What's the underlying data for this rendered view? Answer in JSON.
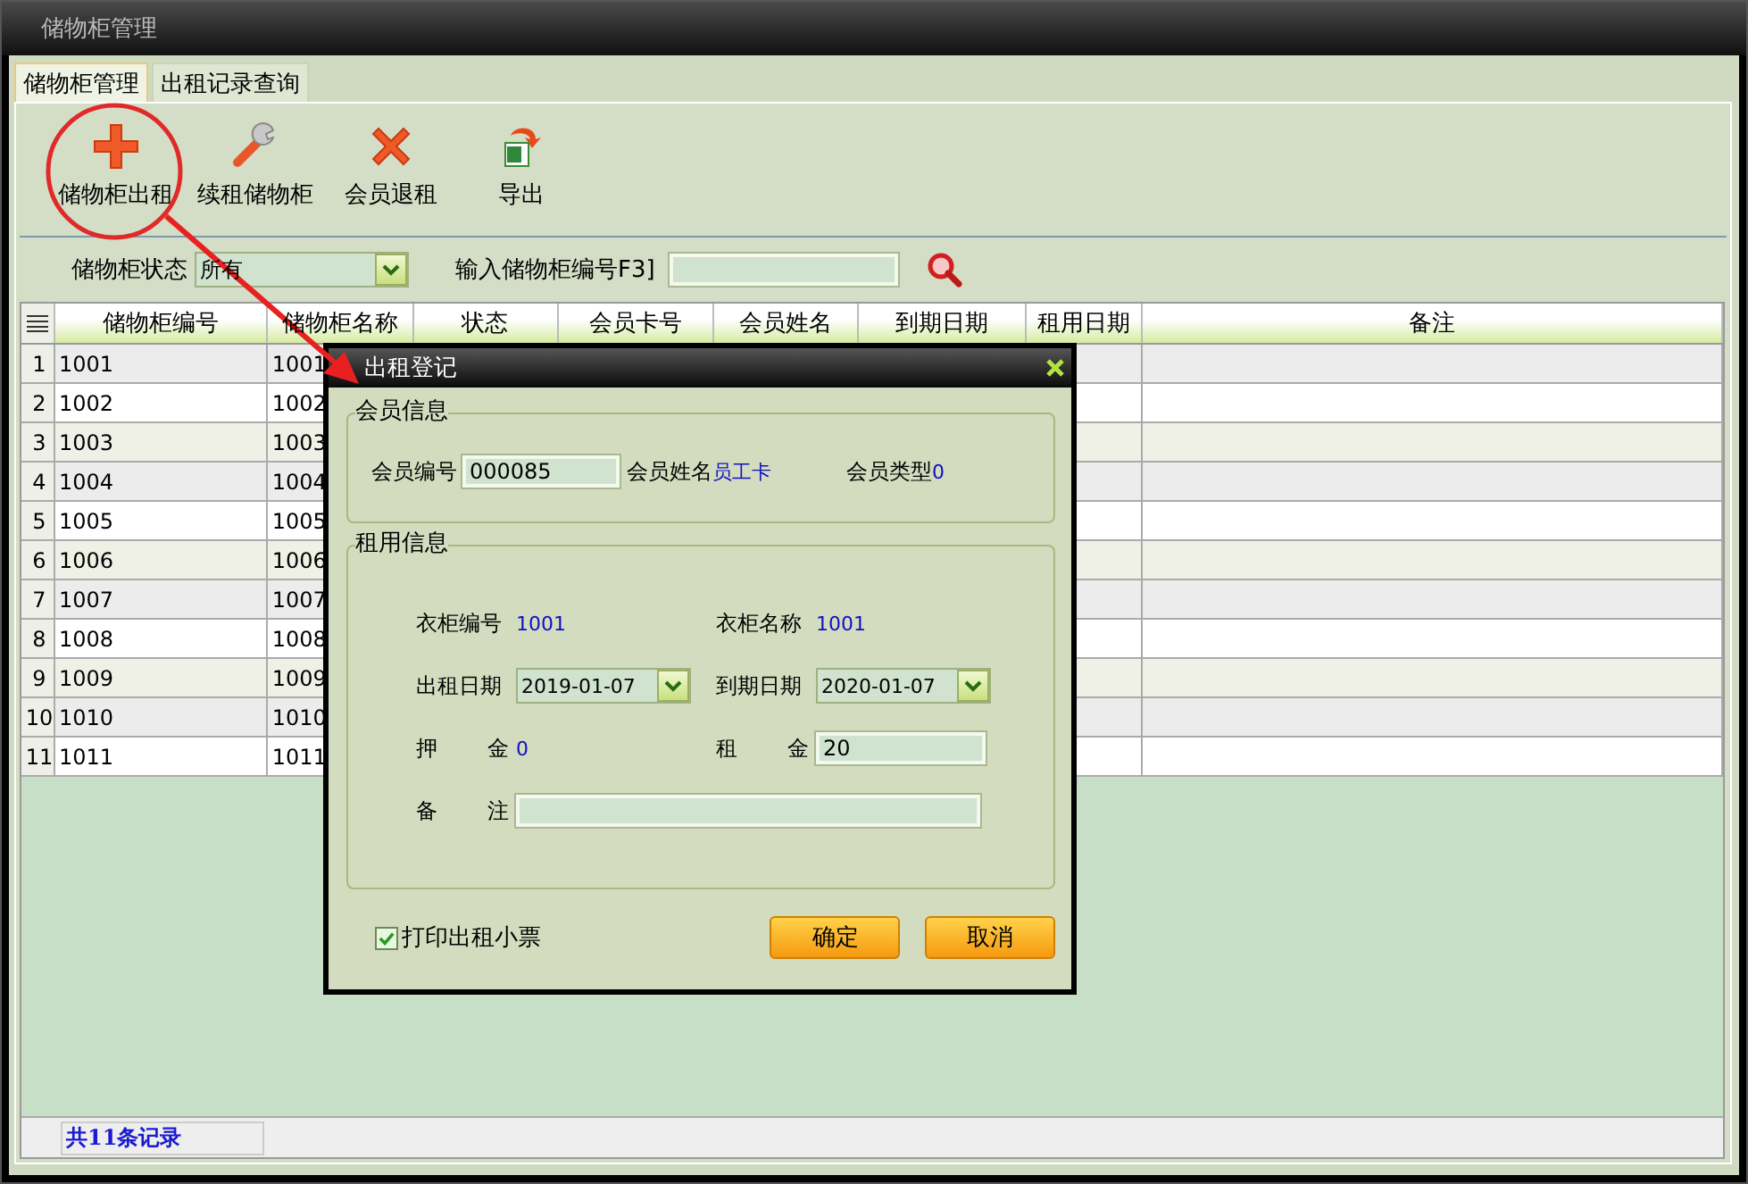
{
  "window": {
    "title": "储物柜管理"
  },
  "tabs": [
    {
      "label": "储物柜管理",
      "selected": true
    },
    {
      "label": "出租记录查询",
      "selected": false
    }
  ],
  "toolbar": [
    {
      "label": "储物柜出租",
      "kind": "add"
    },
    {
      "label": "续租储物柜",
      "kind": "wrench"
    },
    {
      "label": "会员退租",
      "kind": "delete"
    },
    {
      "label": "导出",
      "kind": "export"
    }
  ],
  "filter": {
    "status_label": "储物柜状态",
    "status_value": "所有",
    "search_label": "输入储物柜编号F3]"
  },
  "table": {
    "columns": [
      "储物柜编号",
      "储物柜名称",
      "状态",
      "会员卡号",
      "会员姓名",
      "到期日期",
      "租用日期",
      "备注"
    ],
    "rows": [
      {
        "index": "1",
        "cells": [
          "1001",
          "1001"
        ]
      },
      {
        "index": "2",
        "cells": [
          "1002",
          "1002"
        ]
      },
      {
        "index": "3",
        "cells": [
          "1003",
          "1003"
        ]
      },
      {
        "index": "4",
        "cells": [
          "1004",
          "1004"
        ]
      },
      {
        "index": "5",
        "cells": [
          "1005",
          "1005"
        ]
      },
      {
        "index": "6",
        "cells": [
          "1006",
          "1006"
        ]
      },
      {
        "index": "7",
        "cells": [
          "1007",
          "1007"
        ]
      },
      {
        "index": "8",
        "cells": [
          "1008",
          "1008"
        ]
      },
      {
        "index": "9",
        "cells": [
          "1009",
          "1009"
        ]
      },
      {
        "index": "10",
        "cells": [
          "1010",
          "1010"
        ]
      },
      {
        "index": "11",
        "cells": [
          "1011",
          "1011"
        ]
      }
    ]
  },
  "status_bar": "共11条记录",
  "dialog": {
    "title": "出租登记",
    "member": {
      "title": "会员信息",
      "id_label": "会员编号",
      "id_value": "000085",
      "name_label": "会员姓名",
      "name_value": "员工卡",
      "type_label": "会员类型",
      "type_value": "0"
    },
    "rental": {
      "title": "租用信息",
      "locker_no_label": "衣柜编号",
      "locker_no": "1001",
      "locker_name_label": "衣柜名称",
      "locker_name": "1001",
      "start_label": "出租日期",
      "start_value": "2019-01-07",
      "end_label": "到期日期",
      "end_value": "2020-01-07",
      "deposit_label": "押 金",
      "deposit_value": "0",
      "rent_label": "租 金",
      "rent_value": "20",
      "note_label": "备 注"
    },
    "print_ticket": {
      "label": "打印出租小票",
      "checked": true
    },
    "buttons": [
      "确定",
      "取消"
    ]
  }
}
